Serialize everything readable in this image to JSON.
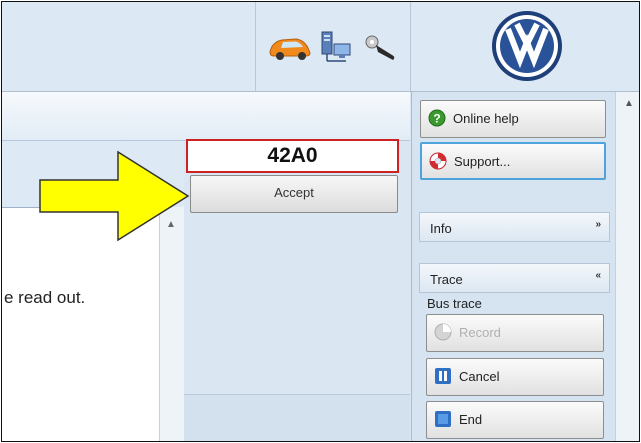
{
  "header": {
    "status_icons": [
      "car-icon",
      "network-icon",
      "key-icon"
    ],
    "logo": "vw-logo"
  },
  "main": {
    "code_value": "42A0",
    "accept_label": "Accept",
    "readout_text": "e read out."
  },
  "sidebar": {
    "online_help_label": "Online help",
    "support_label": "Support...",
    "info_label": "Info",
    "info_chevron": "»",
    "trace_label": "Trace",
    "trace_chevron": "«",
    "bus_trace_label": "Bus trace",
    "record_label": "Record",
    "cancel_label": "Cancel",
    "end_label": "End"
  },
  "colors": {
    "highlight_border": "#cc2222",
    "arrow_fill": "#ffff00",
    "focus_border": "#4ea3dc"
  }
}
